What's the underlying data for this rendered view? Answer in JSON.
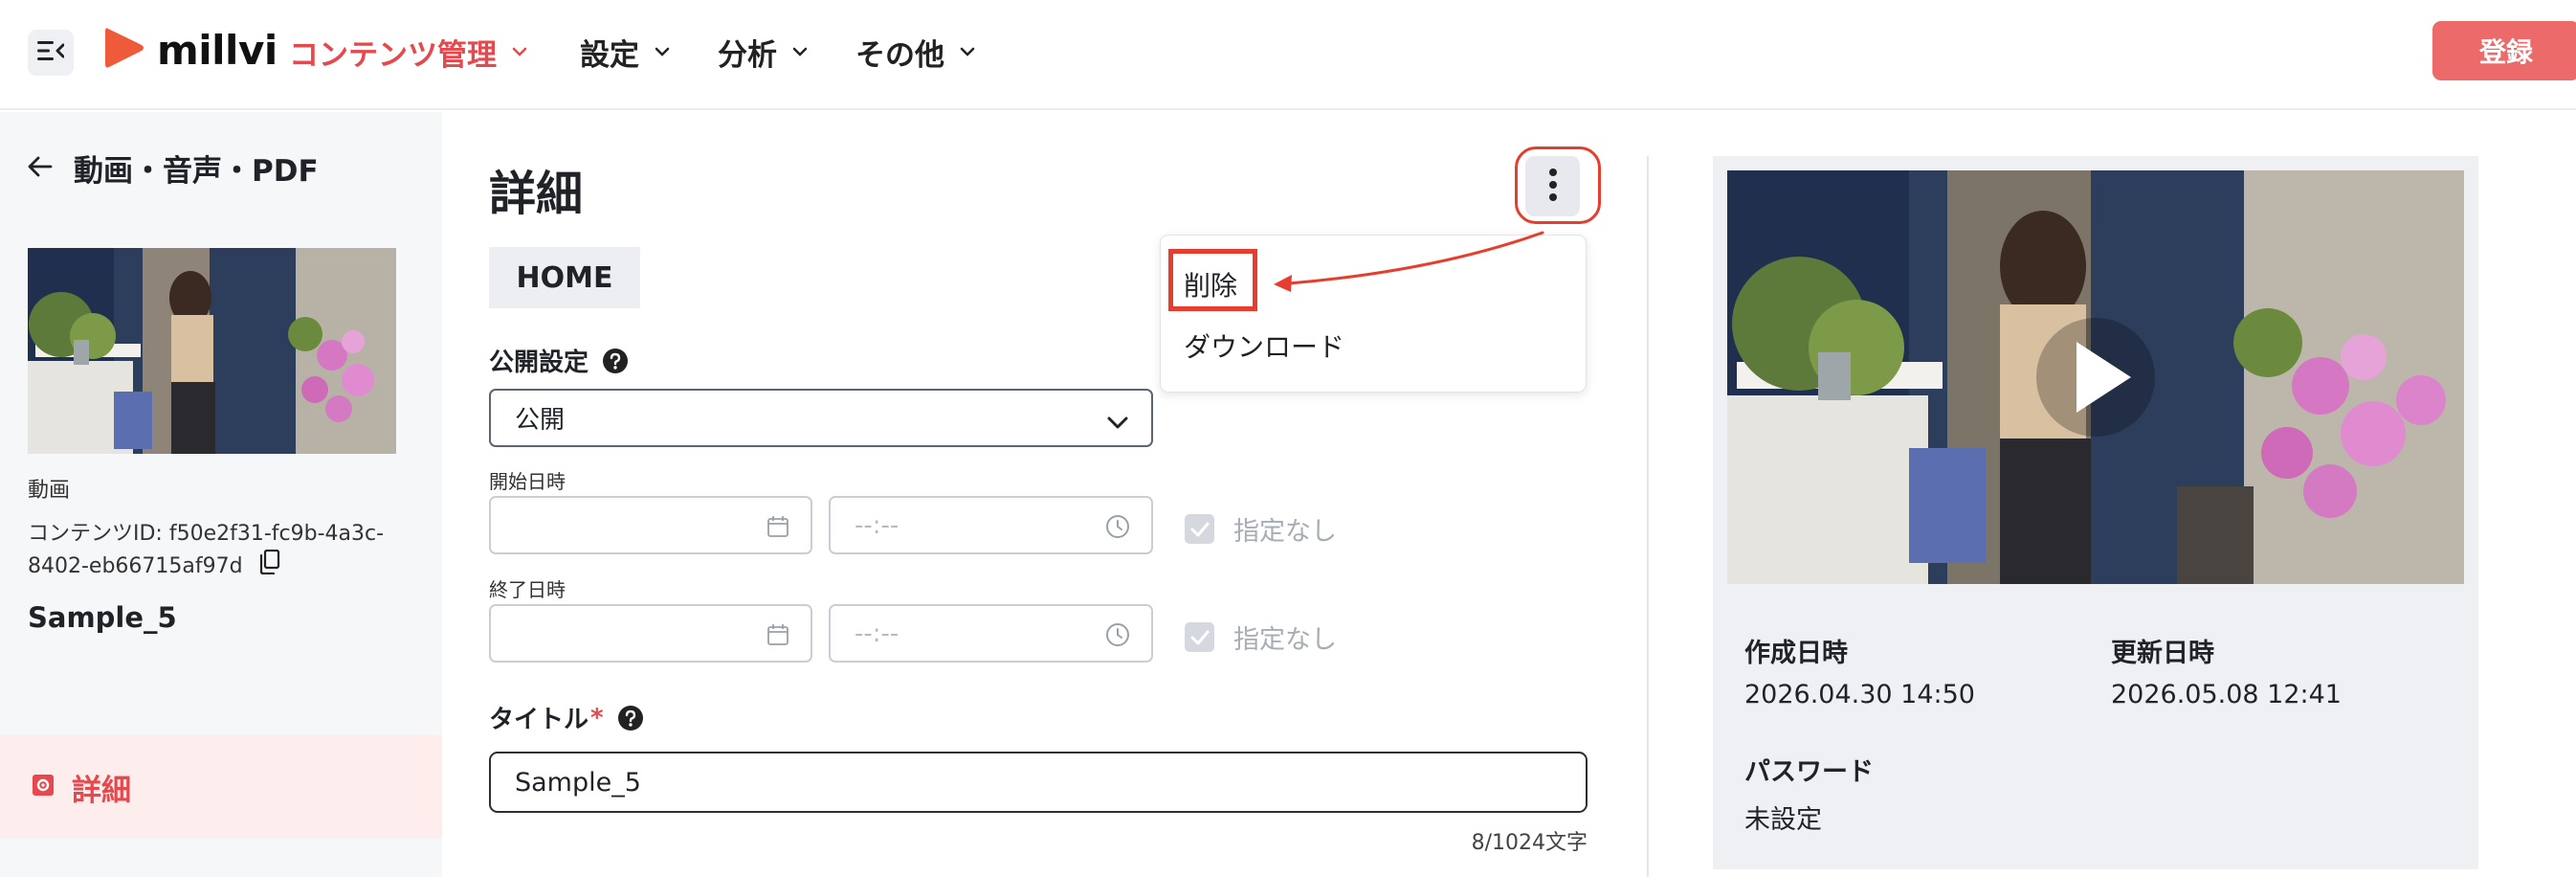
{
  "header": {
    "logo_text": "millvi",
    "nav": [
      {
        "label": "コンテンツ管理",
        "active": true
      },
      {
        "label": "設定",
        "active": false
      },
      {
        "label": "分析",
        "active": false
      },
      {
        "label": "その他",
        "active": false
      }
    ],
    "register_label": "登録",
    "accent_color": "#e5484d"
  },
  "sidebar": {
    "back_label": "動画・音声・PDF",
    "content_type": "動画",
    "content_id_text": "コンテンツID: f50e2f31-fc9b-4a3c-8402-eb66715af97d",
    "content_name": "Sample_5",
    "active_item": "詳細"
  },
  "main": {
    "page_title": "詳細",
    "tag": "HOME",
    "publish_label": "公開設定",
    "publish_value": "公開",
    "start_label": "開始日時",
    "end_label": "終了日時",
    "time_placeholder": "--:--",
    "unspecified_label": "指定なし",
    "title_label": "タイトル",
    "required_mark": "*",
    "title_value": "Sample_5",
    "char_count": "8/1024文字"
  },
  "dropdown": {
    "items": [
      "削除",
      "ダウンロード"
    ]
  },
  "info": {
    "created_label": "作成日時",
    "created_value": "2026.04.30 14:50",
    "updated_label": "更新日時",
    "updated_value": "2026.05.08 12:41",
    "password_label": "パスワード",
    "password_value": "未設定"
  },
  "annotation_color": "#e53e2e"
}
